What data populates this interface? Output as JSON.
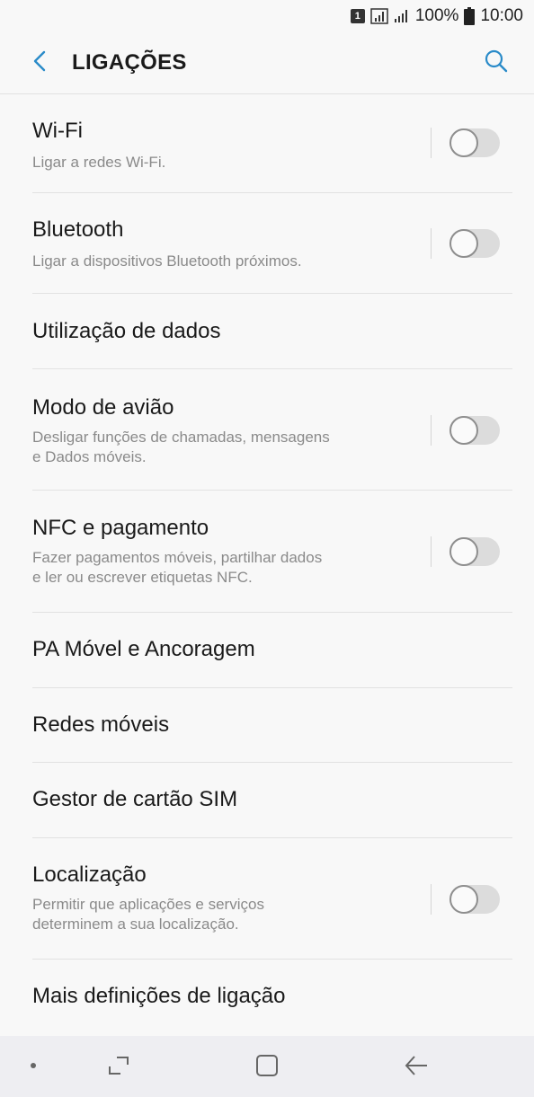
{
  "status_bar": {
    "sim_label": "1",
    "battery_text": "100%",
    "time": "10:00"
  },
  "header": {
    "title": "LIGAÇÕES",
    "back_icon": "chevron-left-icon",
    "search_icon": "search-icon"
  },
  "items": [
    {
      "title": "Wi-Fi",
      "subtitle": "Ligar a redes Wi-Fi.",
      "toggle": false
    },
    {
      "title": "Bluetooth",
      "subtitle": "Ligar a dispositivos Bluetooth próximos.",
      "toggle": false
    },
    {
      "title": "Utilização de dados"
    },
    {
      "title": "Modo de avião",
      "subtitle_line1": "Desligar funções de chamadas, mensagens",
      "subtitle_line2": "e Dados móveis.",
      "toggle": false
    },
    {
      "title": "NFC e pagamento",
      "subtitle_line1": "Fazer pagamentos móveis, partilhar dados",
      "subtitle_line2": "e ler ou escrever etiquetas NFC.",
      "toggle": false
    },
    {
      "title": "PA Móvel e Ancoragem"
    },
    {
      "title": "Redes móveis"
    },
    {
      "title": "Gestor de cartão SIM"
    },
    {
      "title": "Localização",
      "subtitle_line1": "Permitir que aplicações e serviços",
      "subtitle_line2": "determinem a sua localização.",
      "toggle": false
    },
    {
      "title": "Mais definições de ligação"
    }
  ],
  "colors": {
    "background": "#f8f8f8",
    "accent": "#2a8bc9",
    "subtitle": "#8a8a8a",
    "toggle_track": "#dcdcdc"
  }
}
